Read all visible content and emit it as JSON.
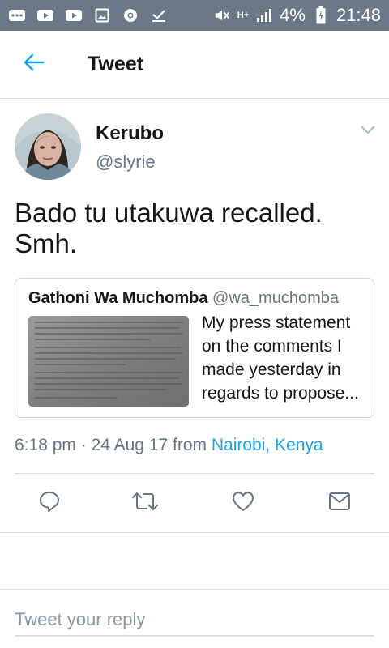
{
  "status_bar": {
    "battery": "4%",
    "time": "21:48",
    "network": "H+",
    "icons": [
      "messages-icon",
      "youtube-icon",
      "youtube-icon",
      "image-icon",
      "chrome-icon",
      "check-icon",
      "mute-icon",
      "signal-icon",
      "battery-charging-icon"
    ]
  },
  "header": {
    "title": "Tweet",
    "back_icon": "back-arrow-icon"
  },
  "tweet": {
    "author_name": "Kerubo",
    "author_handle": "@slyrie",
    "text": "Bado tu utakuwa recalled.\nSmh.",
    "menu_icon": "chevron-down-icon"
  },
  "quote": {
    "author_name": "Gathoni Wa Muchomba",
    "author_handle": "@wa_muchomba",
    "text": "My press statement on the comments I made yesterday in regards to propose..."
  },
  "meta": {
    "time": "6:18 pm",
    "separator": "·",
    "date": "24 Aug 17",
    "from": "from",
    "location": "Nairobi, Kenya"
  },
  "actions": [
    {
      "name": "reply-icon"
    },
    {
      "name": "retweet-icon"
    },
    {
      "name": "like-icon"
    },
    {
      "name": "share-icon"
    }
  ],
  "reply": {
    "placeholder": "Tweet your reply"
  },
  "colors": {
    "accent": "#1da1f2",
    "status_bar": "#6b7888",
    "secondary_text": "#657786",
    "icon": "#657786"
  }
}
